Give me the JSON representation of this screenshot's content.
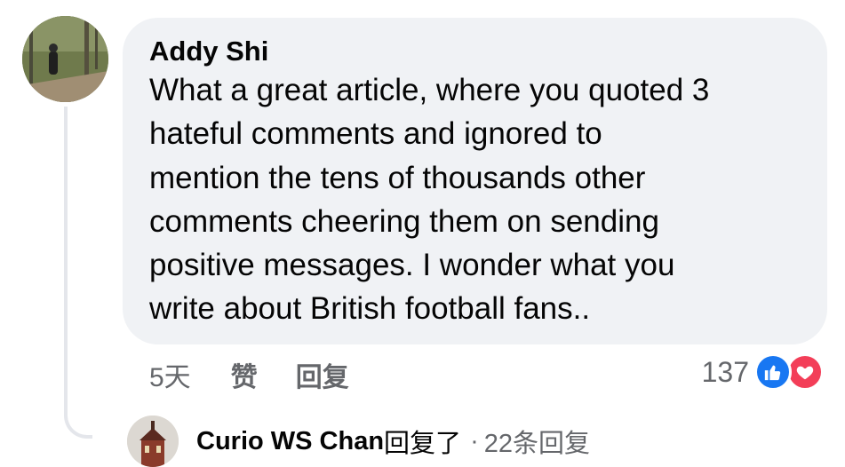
{
  "comment": {
    "author": "Addy Shi",
    "lines": [
      "What a great article, where you quoted 3",
      "hateful comments and ignored to",
      "mention the tens of thousands other",
      "comments cheering them on sending",
      "positive messages. I wonder what you",
      "write about British football fans.."
    ]
  },
  "actions": {
    "time": "5天",
    "like": "赞",
    "reply": "回复"
  },
  "reactions": {
    "count": "137",
    "icons": [
      "like-icon",
      "love-icon"
    ],
    "colors": {
      "like": "#1877f2",
      "love": "#f33e58"
    }
  },
  "reply_preview": {
    "name": "Curio WS Chan",
    "verb": "回复了",
    "separator": "·",
    "count_text": "22条回复"
  }
}
